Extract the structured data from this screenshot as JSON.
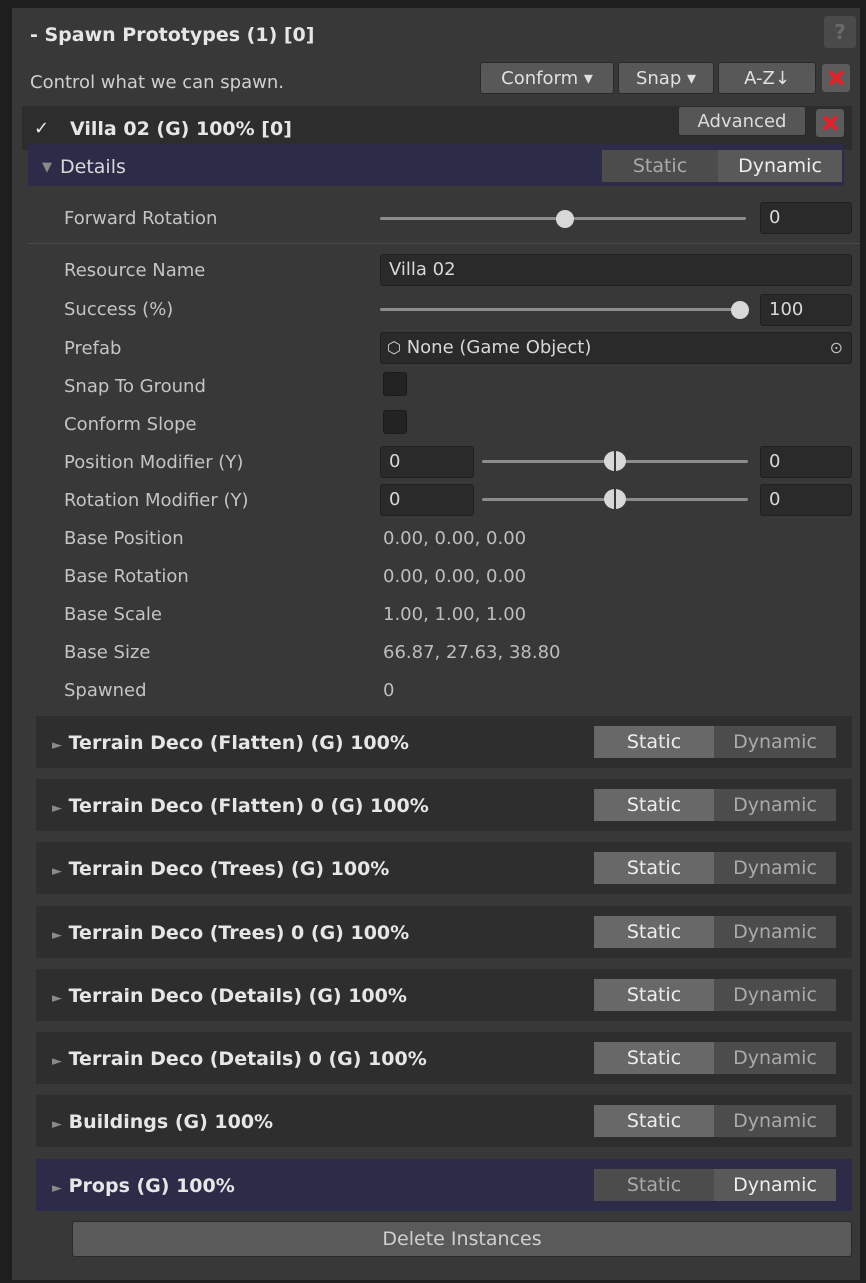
{
  "header": {
    "title": "- Spawn Prototypes (1) [0]",
    "help": "?",
    "subtitle": "Control what we can spawn.",
    "conform_label": "Conform ▾",
    "snap_label": "Snap ▾",
    "sort_label": "A-Z↓"
  },
  "prototype": {
    "checked_glyph": "✓",
    "title": "Villa 02 (G) 100% [0]",
    "advanced_label": "Advanced"
  },
  "details": {
    "toggle": "▼",
    "title": "Details",
    "static_label": "Static",
    "dynamic_label": "Dynamic",
    "selected": "Dynamic"
  },
  "fields": {
    "forward_rotation": {
      "label": "Forward Rotation",
      "value": "0",
      "slider_fraction": 0.5
    },
    "resource_name": {
      "label": "Resource Name",
      "value": "Villa 02"
    },
    "success": {
      "label": "Success (%)",
      "value": "100",
      "slider_fraction": 1.0
    },
    "prefab": {
      "label": "Prefab",
      "value": "None (Game Object)"
    },
    "snap_to_ground": {
      "label": "Snap To Ground",
      "checked": false
    },
    "conform_slope": {
      "label": "Conform Slope",
      "checked": false
    },
    "position_modifier": {
      "label": "Position Modifier (Y)",
      "min": "0",
      "max": "0"
    },
    "rotation_modifier": {
      "label": "Rotation Modifier (Y)",
      "min": "0",
      "max": "0"
    },
    "base_position": {
      "label": "Base Position",
      "value": "0.00, 0.00, 0.00"
    },
    "base_rotation": {
      "label": "Base Rotation",
      "value": "0.00, 0.00, 0.00"
    },
    "base_scale": {
      "label": "Base Scale",
      "value": "1.00, 1.00, 1.00"
    },
    "base_size": {
      "label": "Base Size",
      "value": "66.87, 27.63, 38.80"
    },
    "spawned": {
      "label": "Spawned",
      "value": "0"
    }
  },
  "items": [
    {
      "title": "Terrain Deco (Flatten) (G) 100%",
      "selected": "Static"
    },
    {
      "title": "Terrain Deco (Flatten) 0 (G) 100%",
      "selected": "Static"
    },
    {
      "title": "Terrain Deco (Trees) (G) 100%",
      "selected": "Static"
    },
    {
      "title": "Terrain Deco (Trees) 0 (G) 100%",
      "selected": "Static"
    },
    {
      "title": "Terrain Deco (Details) (G) 100%",
      "selected": "Static"
    },
    {
      "title": "Terrain Deco (Details) 0 (G) 100%",
      "selected": "Static"
    },
    {
      "title": "Buildings (G) 100%",
      "selected": "Static"
    },
    {
      "title": "Props (G) 100%",
      "selected": "Dynamic"
    }
  ],
  "item_toggle": "►",
  "item_static_label": "Static",
  "item_dynamic_label": "Dynamic",
  "delete_label": "Delete Instances",
  "colors": {
    "accent_row": "#2c2c48",
    "delete_red": "#e8202a"
  }
}
